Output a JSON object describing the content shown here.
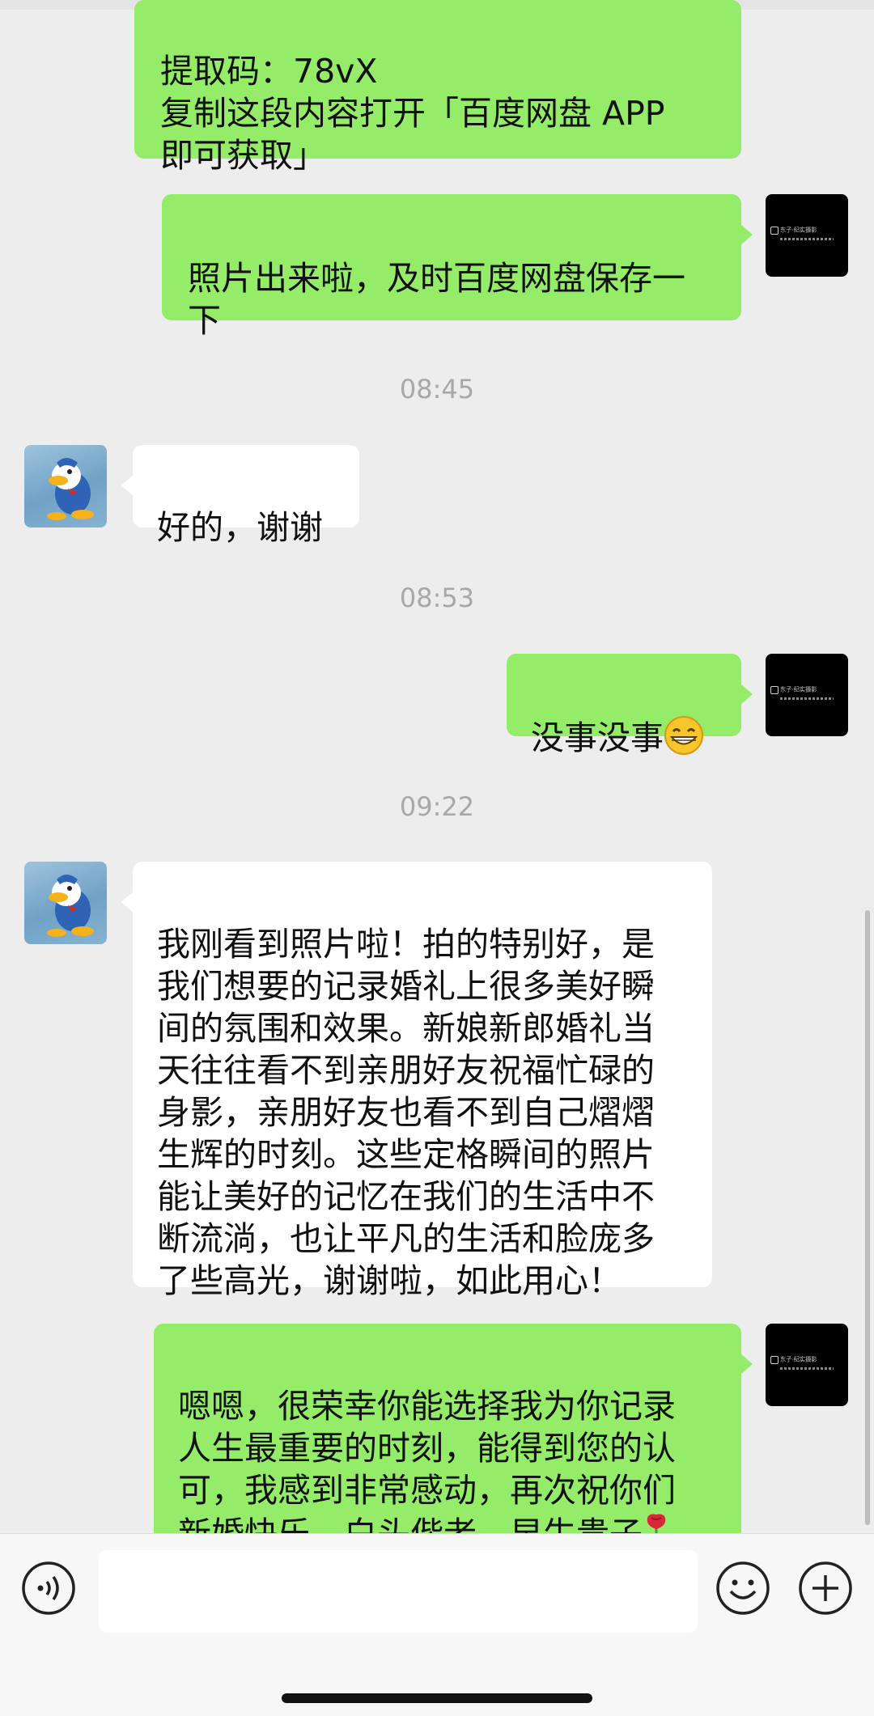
{
  "messages": {
    "m1": {
      "sender": "me",
      "text": "提取码：78vX\n复制这段内容打开「百度网盘 APP\n即可获取」"
    },
    "m2": {
      "sender": "me",
      "text": "照片出来啦，及时百度网盘保存一\n下"
    },
    "t1": "08:45",
    "m3": {
      "sender": "them",
      "text": "好的，谢谢"
    },
    "t2": "08:53",
    "m4": {
      "sender": "me",
      "text": "没事没事",
      "emoji": "grinning-face"
    },
    "t3": "09:22",
    "m5": {
      "sender": "them",
      "text": "我刚看到照片啦！拍的特别好，是\n我们想要的记录婚礼上很多美好瞬\n间的氛围和效果。新娘新郎婚礼当\n天往往看不到亲朋好友祝福忙碌的\n身影，亲朋好友也看不到自己熠熠\n生辉的时刻。这些定格瞬间的照片\n能让美好的记忆在我们的生活中不\n断流淌，也让平凡的生活和脸庞多\n了些高光，谢谢啦，如此用心！"
    },
    "m6": {
      "sender": "me",
      "text": "嗯嗯，很荣幸你能选择我为你记录\n人生最重要的时刻，能得到您的认\n可，我感到非常感动，再次祝你们\n新婚快乐，白头偕老，早生贵子",
      "emoji": "rose"
    }
  },
  "avatars": {
    "me_logo_text": "东子·纪实摄影",
    "them_icon": "cartoon-duck-avatar"
  },
  "input_bar": {
    "voice_icon": "voice-icon",
    "emoji_icon": "emoji-icon",
    "plus_icon": "plus-icon",
    "text_value": ""
  },
  "colors": {
    "sent_bubble": "#95ec69",
    "received_bubble": "#ffffff",
    "background": "#ededed",
    "timestamp": "#a8a8a8"
  }
}
